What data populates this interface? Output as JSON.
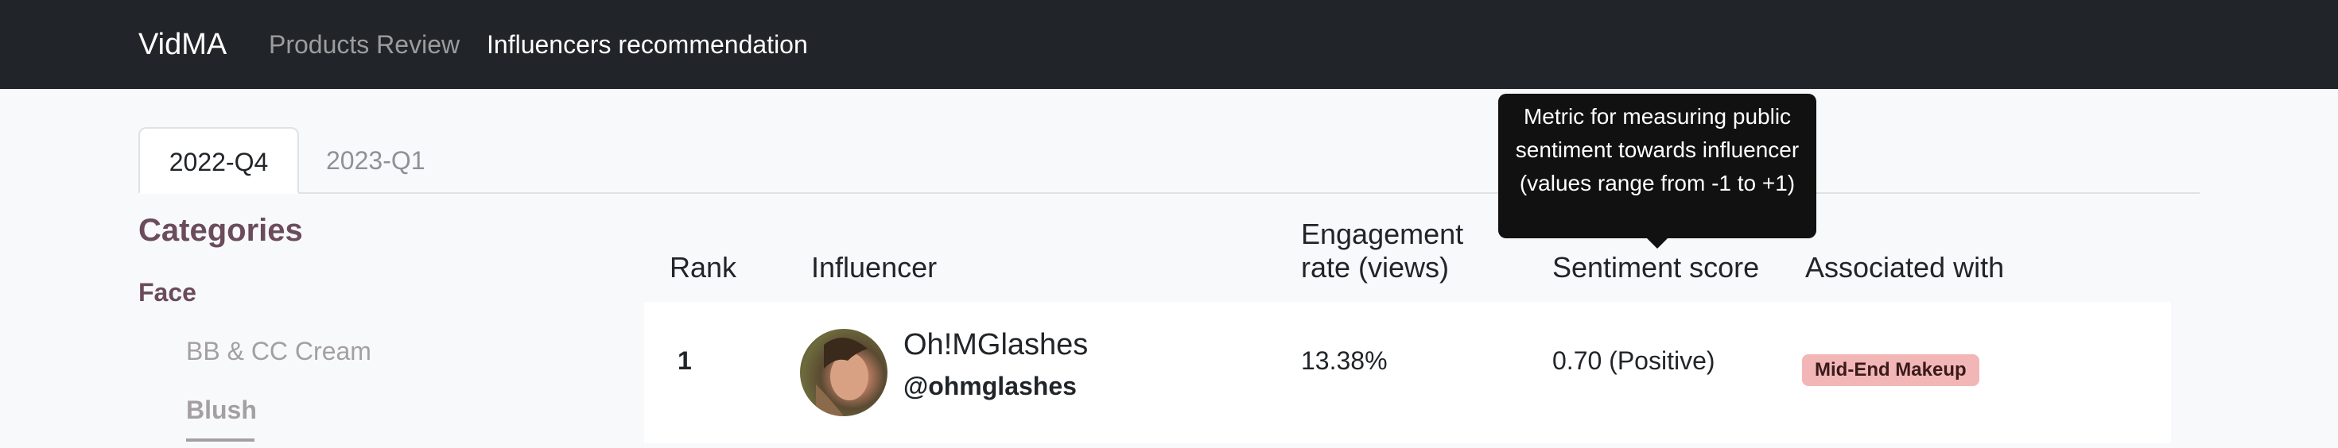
{
  "navbar": {
    "brand": "VidMA",
    "links": [
      {
        "label": "Products Review",
        "active": false
      },
      {
        "label": "Influencers recommendation",
        "active": true
      }
    ]
  },
  "tabs": [
    {
      "label": "2022-Q4",
      "active": true
    },
    {
      "label": "2023-Q1",
      "active": false
    }
  ],
  "sidebar": {
    "title": "Categories",
    "group": "Face",
    "items": [
      {
        "label": "BB & CC Cream",
        "active": false
      },
      {
        "label": "Blush",
        "active": true
      }
    ]
  },
  "table": {
    "headers": {
      "rank": "Rank",
      "influencer": "Influencer",
      "engagement": "Engagement rate (views)",
      "sentiment": "Sentiment score",
      "associated": "Associated with"
    },
    "rows": [
      {
        "rank": "1",
        "name": "Oh!MGlashes",
        "handle": "@ohmglashes",
        "engagement": "13.38%",
        "sentiment": "0.70 (Positive)",
        "tag": "Mid-End Makeup"
      }
    ]
  },
  "tooltip": {
    "text": "Metric for measuring public sentiment towards influencer (values range from -1 to +1)"
  },
  "colors": {
    "navbar_bg": "#212529",
    "category_accent": "#6b4c5a",
    "badge_bg": "#f2b6b6",
    "tooltip_bg": "#111111"
  }
}
